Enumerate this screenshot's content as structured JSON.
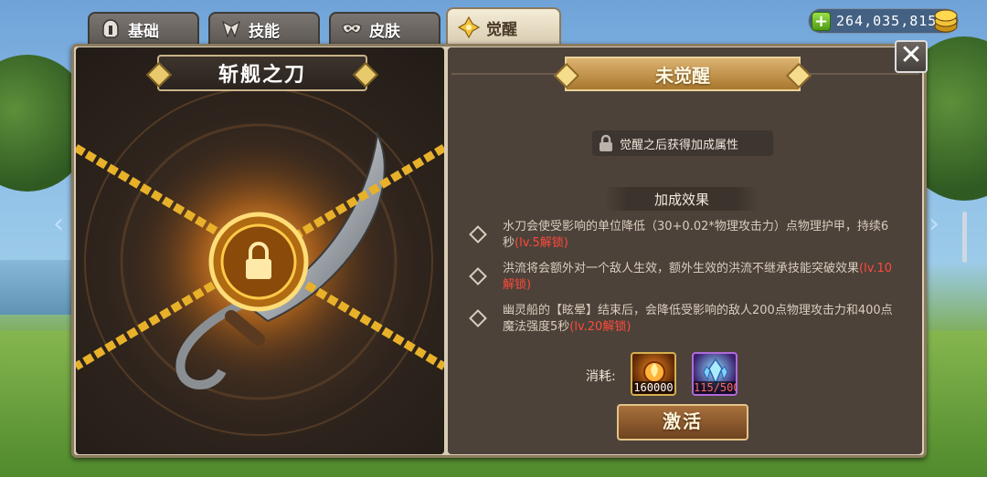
{
  "tabs": [
    {
      "label": "基础",
      "icon": "helmet-icon",
      "active": false
    },
    {
      "label": "技能",
      "icon": "skill-icon",
      "active": false
    },
    {
      "label": "皮肤",
      "icon": "mask-icon",
      "active": false
    },
    {
      "label": "觉醒",
      "icon": "awaken-icon",
      "active": true
    }
  ],
  "currency": {
    "gold": "264,035,815",
    "add_icon": "plus-icon",
    "coin_icon": "gold-coin-icon"
  },
  "weapon": {
    "name": "斩舰之刀"
  },
  "status": {
    "label": "未觉醒"
  },
  "hint": {
    "text": "觉醒之后获得加成属性"
  },
  "effects": {
    "title": "加成效果",
    "items": [
      {
        "text": "水刀会使受影响的单位降低（30+0.02*物理攻击力）点物理护甲，持续6秒",
        "unlock": "(lv.5解锁)"
      },
      {
        "text": "洪流将会额外对一个敌人生效，额外生效的洪流不继承技能突破效果",
        "unlock": "(lv.10解锁)"
      },
      {
        "text": "幽灵船的【眩晕】结束后，会降低受影响的敌人200点物理攻击力和400点魔法强度5秒",
        "unlock": "(lv.20解锁)"
      }
    ]
  },
  "cost": {
    "label": "消耗:",
    "items": [
      {
        "icon": "fire-orb-icon",
        "count": "160000"
      },
      {
        "icon": "blue-crystal-icon",
        "count": "115/500"
      }
    ]
  },
  "activate_label": "激活",
  "colors": {
    "accent": "#dcb370",
    "unlock": "#ff4a3a"
  }
}
